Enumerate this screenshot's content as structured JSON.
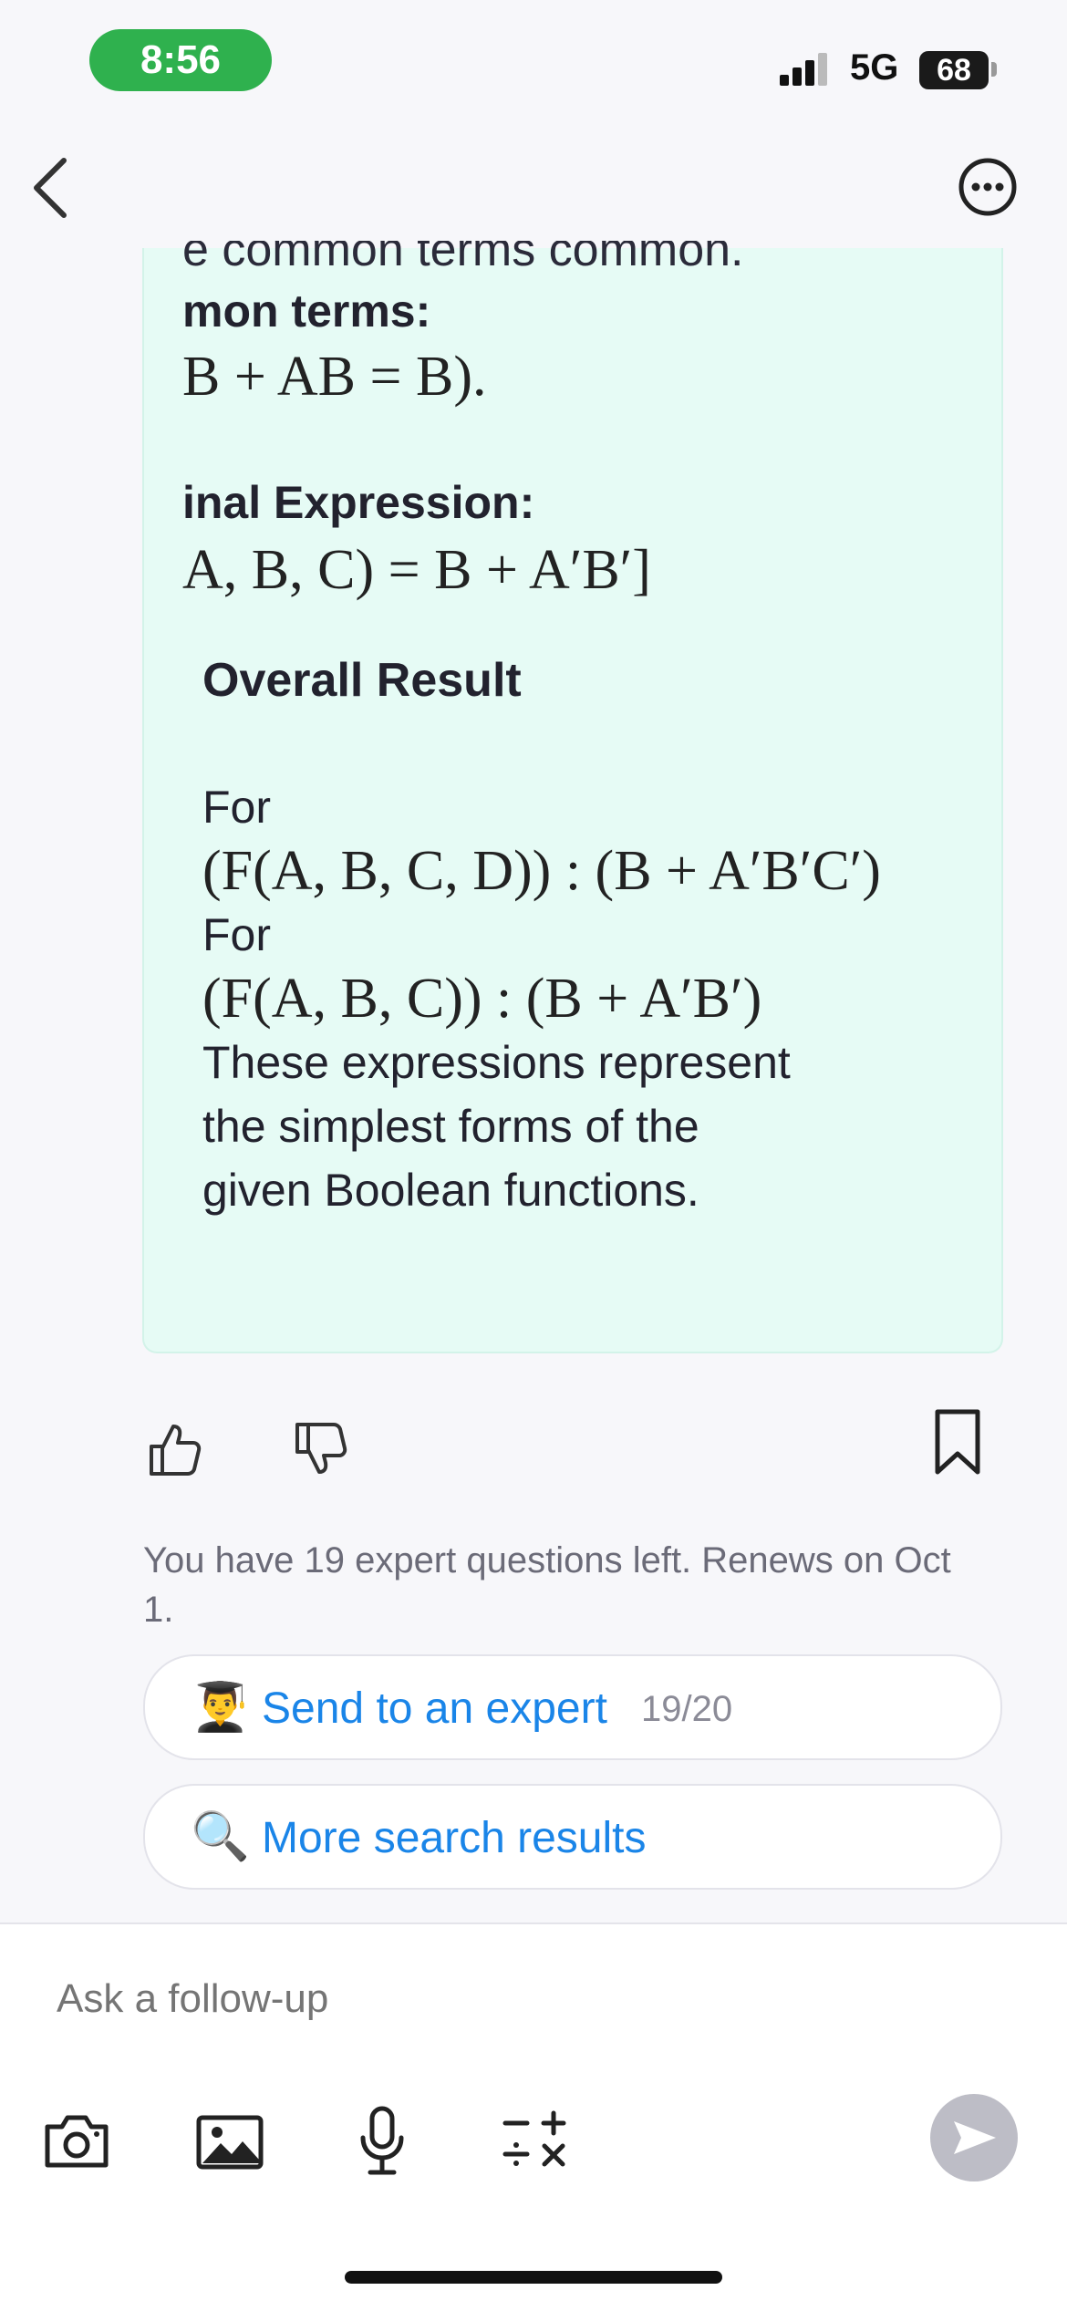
{
  "status_bar": {
    "time": "8:56",
    "network": "5G",
    "battery": "68"
  },
  "answer": {
    "fragments": {
      "cut_line": "e common terms common.",
      "common_terms_heading": "mon terms:",
      "common_terms_math": "B + AB = B).",
      "final_heading": "inal Expression:",
      "final_math": "A, B, C) = B + A′B′]"
    },
    "overall_title": "Overall Result",
    "for1": "For",
    "expr1": "(F(A, B, C, D)) : (B + A′B′C′)",
    "for2": "For",
    "expr2": "(F(A, B, C)) : (B + A′B′)",
    "summary_lines": [
      "These expressions represent",
      "the simplest forms of the",
      "given Boolean functions."
    ]
  },
  "feedback": {
    "quota_text": "You have 19 expert questions left. Renews on Oct 1."
  },
  "actions": {
    "expert": {
      "emoji": "👨‍🎓",
      "label": "Send to an expert",
      "count": "19/20"
    },
    "search": {
      "emoji": "🔍",
      "label": "More search results"
    }
  },
  "composer": {
    "placeholder": "Ask a follow-up"
  }
}
